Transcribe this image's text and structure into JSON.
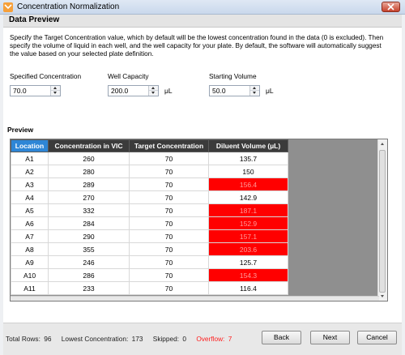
{
  "window": {
    "title": "Concentration Normalization",
    "accent_close": "#c6422c"
  },
  "section": {
    "title": "Data Preview"
  },
  "description": "Specify the Target Concentration value, which by default will be the lowest concentration found in the data (0 is excluded). Then specify the volume of liquid in each well, and the well capacity for your plate. By default, the software will automatically suggest the value based on your selected plate definition.",
  "fields": {
    "specified_concentration": {
      "label": "Specified Concentration",
      "value": "70.0"
    },
    "well_capacity": {
      "label": "Well Capacity",
      "value": "200.0",
      "unit": "μL"
    },
    "starting_volume": {
      "label": "Starting Volume",
      "value": "50.0",
      "unit": "μL"
    }
  },
  "preview": {
    "label": "Preview",
    "columns": [
      "Location",
      "Concentration in VIC",
      "Target Concentration",
      "Diluent Volume (µL)"
    ],
    "rows": [
      {
        "location": "A1",
        "conc": "260",
        "target": "70",
        "diluent": "135.7",
        "overflow": false
      },
      {
        "location": "A2",
        "conc": "280",
        "target": "70",
        "diluent": "150",
        "overflow": false
      },
      {
        "location": "A3",
        "conc": "289",
        "target": "70",
        "diluent": "156.4",
        "overflow": true
      },
      {
        "location": "A4",
        "conc": "270",
        "target": "70",
        "diluent": "142.9",
        "overflow": false
      },
      {
        "location": "A5",
        "conc": "332",
        "target": "70",
        "diluent": "187.1",
        "overflow": true
      },
      {
        "location": "A6",
        "conc": "284",
        "target": "70",
        "diluent": "152.9",
        "overflow": true
      },
      {
        "location": "A7",
        "conc": "290",
        "target": "70",
        "diluent": "157.1",
        "overflow": true
      },
      {
        "location": "A8",
        "conc": "355",
        "target": "70",
        "diluent": "203.6",
        "overflow": true
      },
      {
        "location": "A9",
        "conc": "246",
        "target": "70",
        "diluent": "125.7",
        "overflow": false
      },
      {
        "location": "A10",
        "conc": "286",
        "target": "70",
        "diluent": "154.3",
        "overflow": true
      },
      {
        "location": "A11",
        "conc": "233",
        "target": "70",
        "diluent": "116.4",
        "overflow": false
      }
    ],
    "overflow_color": "#ff0000",
    "header_selected_color": "#2e86d6"
  },
  "footer": {
    "total_rows_label": "Total Rows:",
    "total_rows": "96",
    "lowest_label": "Lowest Concentration:",
    "lowest": "173",
    "skipped_label": "Skipped:",
    "skipped": "0",
    "overflow_label": "Overflow:",
    "overflow": "7",
    "back": "Back",
    "next": "Next",
    "cancel": "Cancel"
  }
}
